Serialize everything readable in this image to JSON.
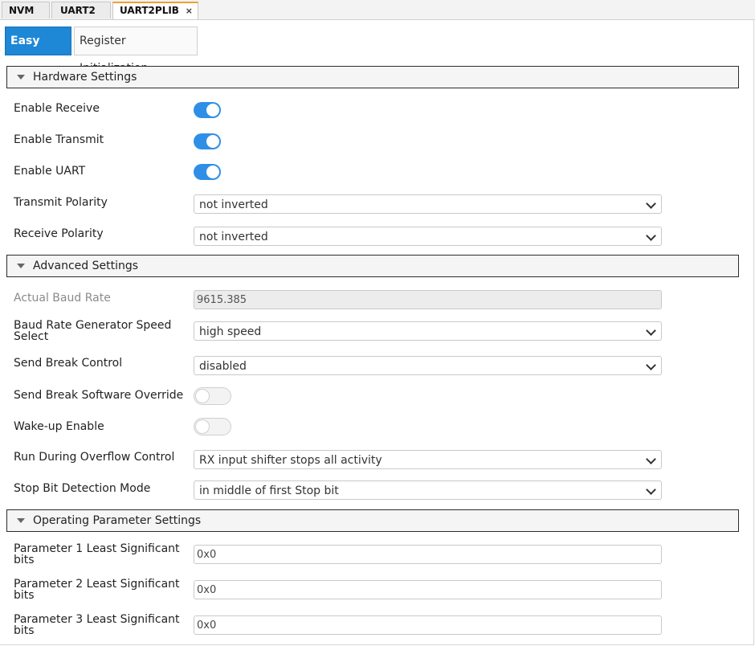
{
  "file_tabs": [
    {
      "label": "NVM"
    },
    {
      "label": "UART2"
    },
    {
      "label": "UART2PLIB",
      "close": "×"
    }
  ],
  "view_tabs": {
    "easy": "Easy View",
    "register": "Register Initialization"
  },
  "sections": {
    "hardware": "Hardware Settings",
    "advanced": "Advanced Settings",
    "operating": "Operating Parameter Settings"
  },
  "hardware": {
    "enable_receive": {
      "label": "Enable Receive",
      "value": true
    },
    "enable_transmit": {
      "label": "Enable Transmit",
      "value": true
    },
    "enable_uart": {
      "label": "Enable UART",
      "value": true
    },
    "transmit_polarity": {
      "label": "Transmit Polarity",
      "value": "not inverted"
    },
    "receive_polarity": {
      "label": "Receive Polarity",
      "value": "not inverted"
    }
  },
  "advanced": {
    "actual_baud": {
      "label": "Actual Baud Rate",
      "value": "9615.385"
    },
    "brg_speed": {
      "label1": "Baud Rate Generator Speed",
      "label2": "Select",
      "value": "high speed"
    },
    "send_break": {
      "label": "Send Break Control",
      "value": "disabled"
    },
    "send_break_override": {
      "label": "Send Break Software Override",
      "value": false
    },
    "wakeup": {
      "label": "Wake-up Enable",
      "value": false
    },
    "run_overflow": {
      "label": "Run During Overflow Control",
      "value": "RX input shifter stops all activity"
    },
    "stop_bit": {
      "label": "Stop Bit Detection Mode",
      "value": "in middle of first Stop bit"
    }
  },
  "operating": {
    "param1": {
      "label1": "Parameter 1 Least Significant",
      "label2": "bits",
      "value": "0x0"
    },
    "param2": {
      "label1": "Parameter 2 Least Significant",
      "label2": "bits",
      "value": "0x0"
    },
    "param3": {
      "label1": "Parameter 3 Least Significant",
      "label2": "bits",
      "value": "0x0"
    }
  },
  "colors": {
    "accent": "#1e87d6",
    "toggle_on": "#2f8fe6",
    "active_tab_marker": "#f0a030"
  }
}
